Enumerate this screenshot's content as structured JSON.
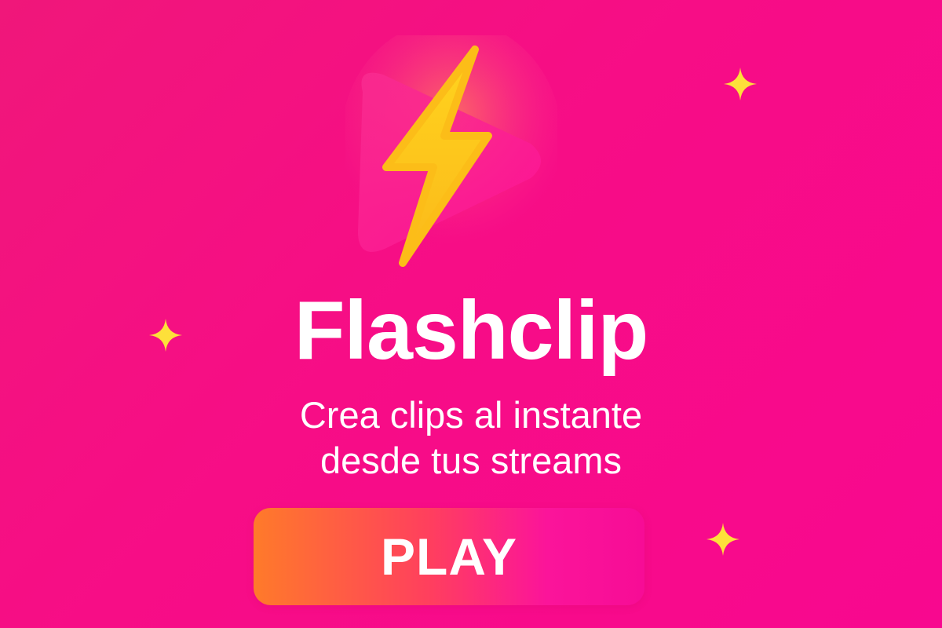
{
  "app": {
    "title": "Flashclip",
    "tagline_line1": "Crea clips al instante",
    "tagline_line2": "desde tus streams",
    "play_label": "PLAY"
  },
  "logo": {
    "icons": [
      "play-triangle-icon",
      "lightning-bolt-icon"
    ]
  },
  "decorations": [
    "sparkle-icon",
    "sparkle-icon",
    "sparkle-icon"
  ],
  "colors": {
    "background": "#f70d86",
    "bolt": "#fdc21b",
    "sparkle": "#fde03a",
    "button_start": "#ff7a2a",
    "button_end": "#f70c96",
    "text": "#ffffff"
  }
}
